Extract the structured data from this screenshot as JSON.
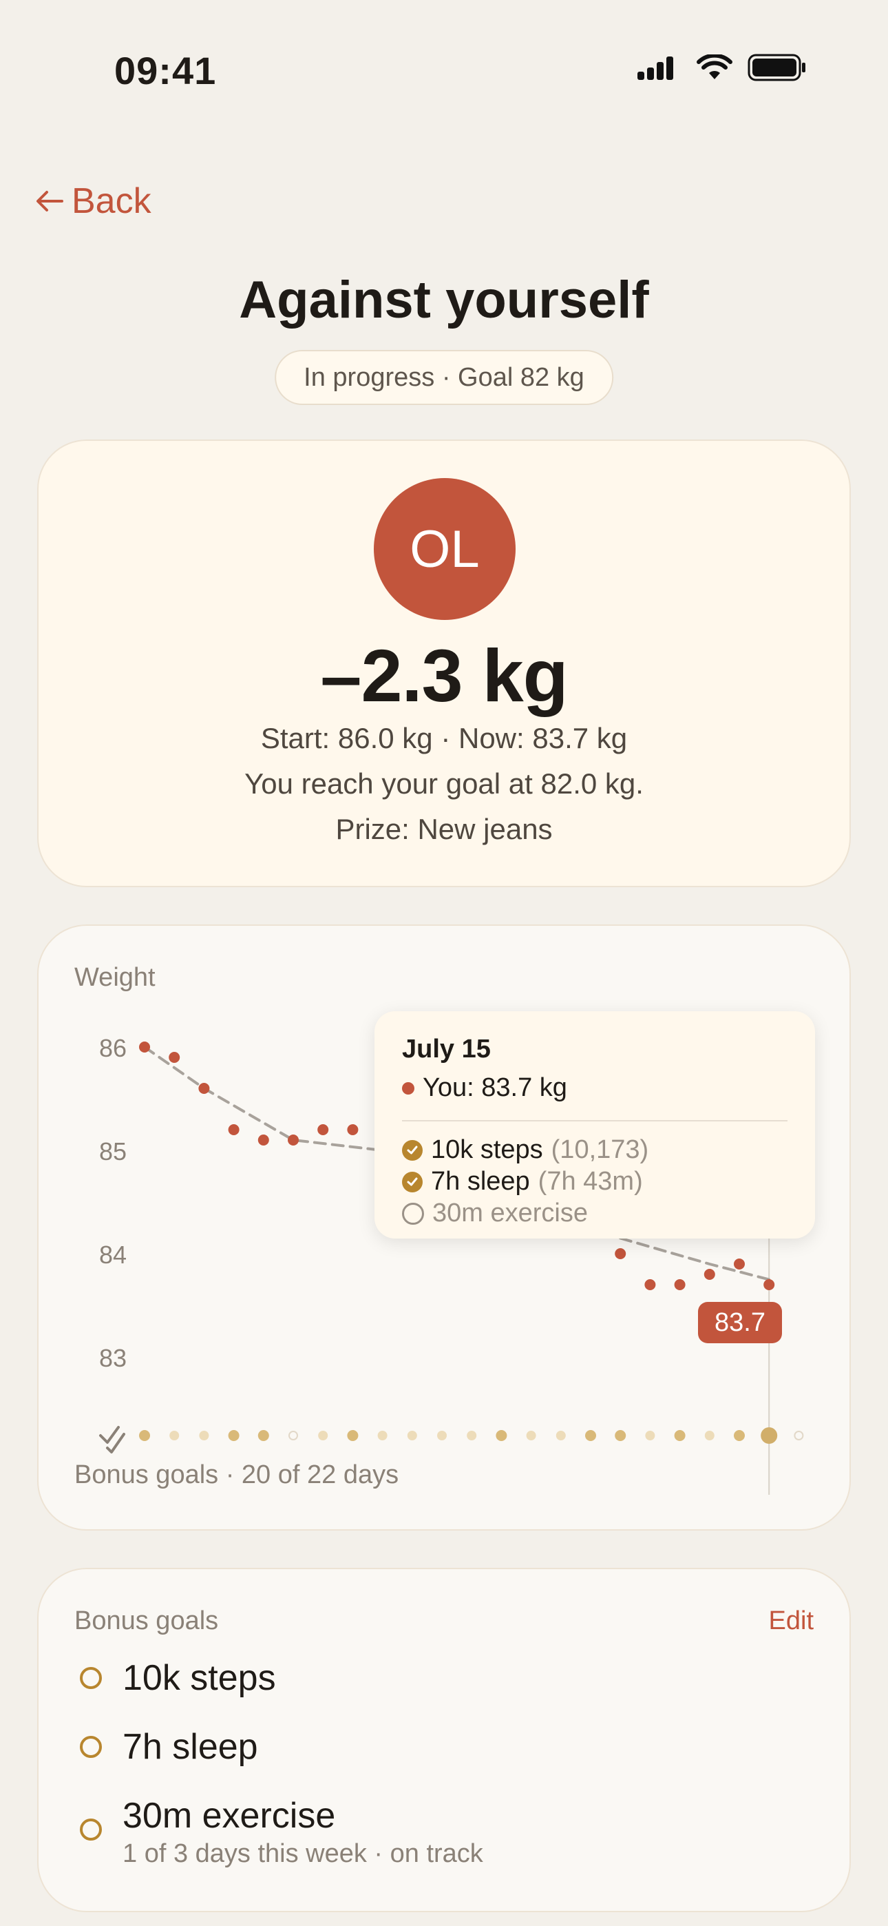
{
  "status_bar": {
    "time": "09:41"
  },
  "nav": {
    "back_label": "Back"
  },
  "header": {
    "title": "Against yourself",
    "status_pill": "In progress · Goal 82 kg"
  },
  "summary": {
    "avatar_initials": "OL",
    "delta": "–2.3 kg",
    "start_now": "Start: 86.0 kg · Now: 83.7 kg",
    "goal_text": "You reach your goal at 82.0 kg.",
    "prize": "Prize: New jeans"
  },
  "chart": {
    "label": "Weight",
    "bonus_caption": "Bonus goals · 20 of 22 days",
    "current_badge": "83.7",
    "tooltip": {
      "date": "July 15",
      "you": "You: 83.7 kg",
      "goals": [
        {
          "name": "10k steps",
          "detail": "(10,173)",
          "done": true
        },
        {
          "name": "7h sleep",
          "detail": "(7h 43m)",
          "done": true
        },
        {
          "name": "30m exercise",
          "detail": "",
          "done": false
        }
      ]
    }
  },
  "chart_data": {
    "type": "scatter",
    "title": "Weight",
    "y_ticks": [
      "86",
      "85",
      "84",
      "83"
    ],
    "ylim": [
      82.6,
      86.2
    ],
    "grid": false,
    "series": [
      {
        "name": "You",
        "color": "#C2553C",
        "points": [
          [
            1,
            86.0
          ],
          [
            2,
            85.9
          ],
          [
            3,
            85.6
          ],
          [
            4,
            85.2
          ],
          [
            5,
            85.1
          ],
          [
            6,
            85.1
          ],
          [
            7,
            85.2
          ],
          [
            8,
            85.2
          ],
          [
            17,
            84.0
          ],
          [
            18,
            83.7
          ],
          [
            19,
            83.7
          ],
          [
            20,
            83.8
          ],
          [
            21,
            83.9
          ],
          [
            22,
            83.7
          ]
        ]
      },
      {
        "name": "Trend",
        "color": "#A8A29B",
        "style": "dashed",
        "points": [
          [
            1,
            86.0
          ],
          [
            3,
            85.6
          ],
          [
            6,
            85.1
          ],
          [
            9,
            85.0
          ],
          [
            17,
            84.15
          ],
          [
            20,
            83.9
          ],
          [
            22,
            83.75
          ]
        ]
      }
    ],
    "bonus_days": {
      "count": 23,
      "status": [
        "done",
        "partial",
        "partial",
        "done",
        "done",
        "missed",
        "partial",
        "done",
        "partial",
        "partial",
        "partial",
        "partial",
        "done",
        "partial",
        "partial",
        "done",
        "done",
        "partial",
        "done",
        "partial",
        "done",
        "today",
        "missed"
      ]
    },
    "highlight": {
      "day": 22,
      "value": 83.7
    }
  },
  "bonus_goals": {
    "title": "Bonus goals",
    "edit_label": "Edit",
    "items": [
      {
        "name": "10k steps",
        "sub": ""
      },
      {
        "name": "7h sleep",
        "sub": ""
      },
      {
        "name": "30m exercise",
        "sub": "1 of 3 days this week · on track"
      }
    ]
  },
  "colors": {
    "accent": "#C2553C",
    "gold": "#B8862E",
    "background": "#F3F0EA"
  }
}
